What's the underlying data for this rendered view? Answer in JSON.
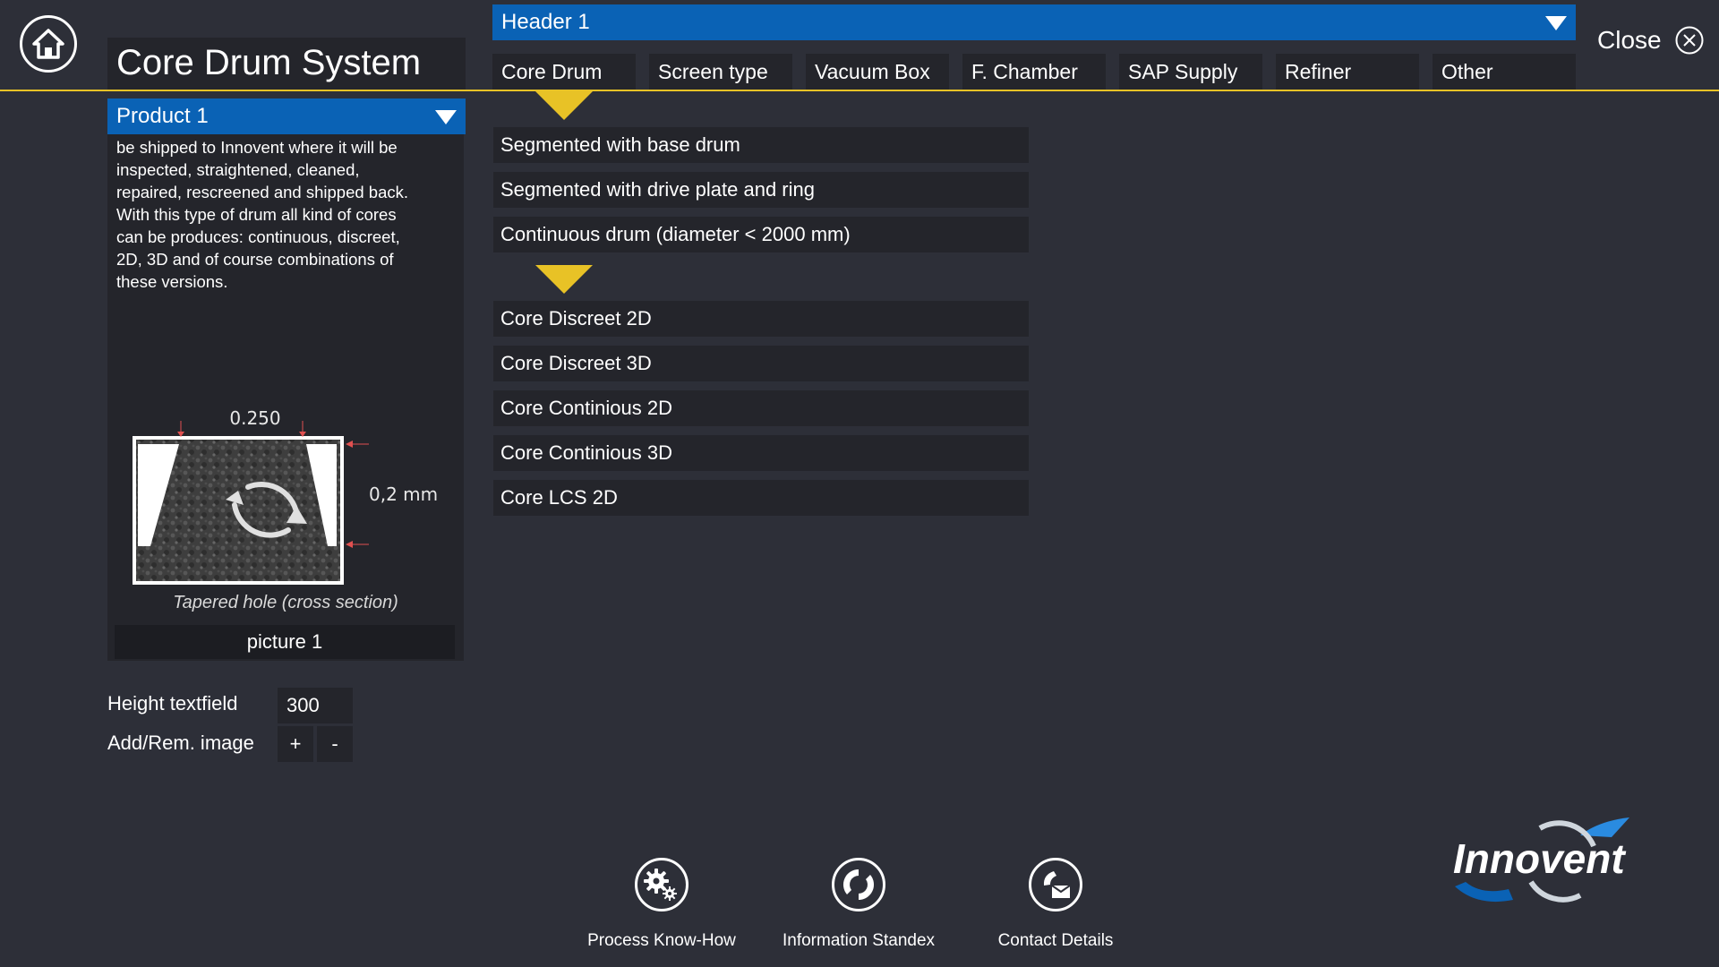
{
  "app": {
    "title": "Core Drum System"
  },
  "header": {
    "selected": "Header 1"
  },
  "close_label": "Close",
  "tabs": [
    {
      "label": "Core Drum"
    },
    {
      "label": "Screen type"
    },
    {
      "label": "Vacuum Box"
    },
    {
      "label": "F. Chamber"
    },
    {
      "label": "SAP Supply"
    },
    {
      "label": "Refiner"
    },
    {
      "label": "Other"
    }
  ],
  "drum_types": [
    {
      "label": "Segmented with base drum"
    },
    {
      "label": "Segmented with drive plate and ring"
    },
    {
      "label": "Continuous drum (diameter < 2000 mm)"
    }
  ],
  "core_types": [
    {
      "label": "Core Discreet 2D"
    },
    {
      "label": "Core Discreet 3D"
    },
    {
      "label": "Core Continious 2D"
    },
    {
      "label": "Core Continious 3D"
    },
    {
      "label": "Core LCS 2D"
    }
  ],
  "product": {
    "selected": "Product 1",
    "description": [
      "be shipped to Innovent where it will be",
      "inspected, straightened, cleaned,",
      "repaired, rescreened and shipped back.",
      "With this type of drum all kind of cores",
      "can be produces: continuous, discreet,",
      "2D, 3D and of course combinations of",
      "these versions."
    ],
    "diagram": {
      "width_label": "0.250",
      "depth_label": "0,2 mm",
      "caption": "Tapered hole (cross section)"
    },
    "picture_label": "picture 1"
  },
  "controls": {
    "height_label": "Height textfield",
    "height_value": "300",
    "addrem_label": "Add/Rem. image",
    "add": "+",
    "remove": "-"
  },
  "footer": [
    {
      "label": "Process Know-How",
      "icon": "gears-icon"
    },
    {
      "label": "Information Standex",
      "icon": "info-swirl-icon"
    },
    {
      "label": "Contact Details",
      "icon": "contact-icon"
    }
  ],
  "logo": {
    "text": "Innovent"
  },
  "colors": {
    "accent_blue": "#0a62b5",
    "accent_yellow": "#e8c226",
    "background": "#2d2f38",
    "panel": "#24252b"
  }
}
